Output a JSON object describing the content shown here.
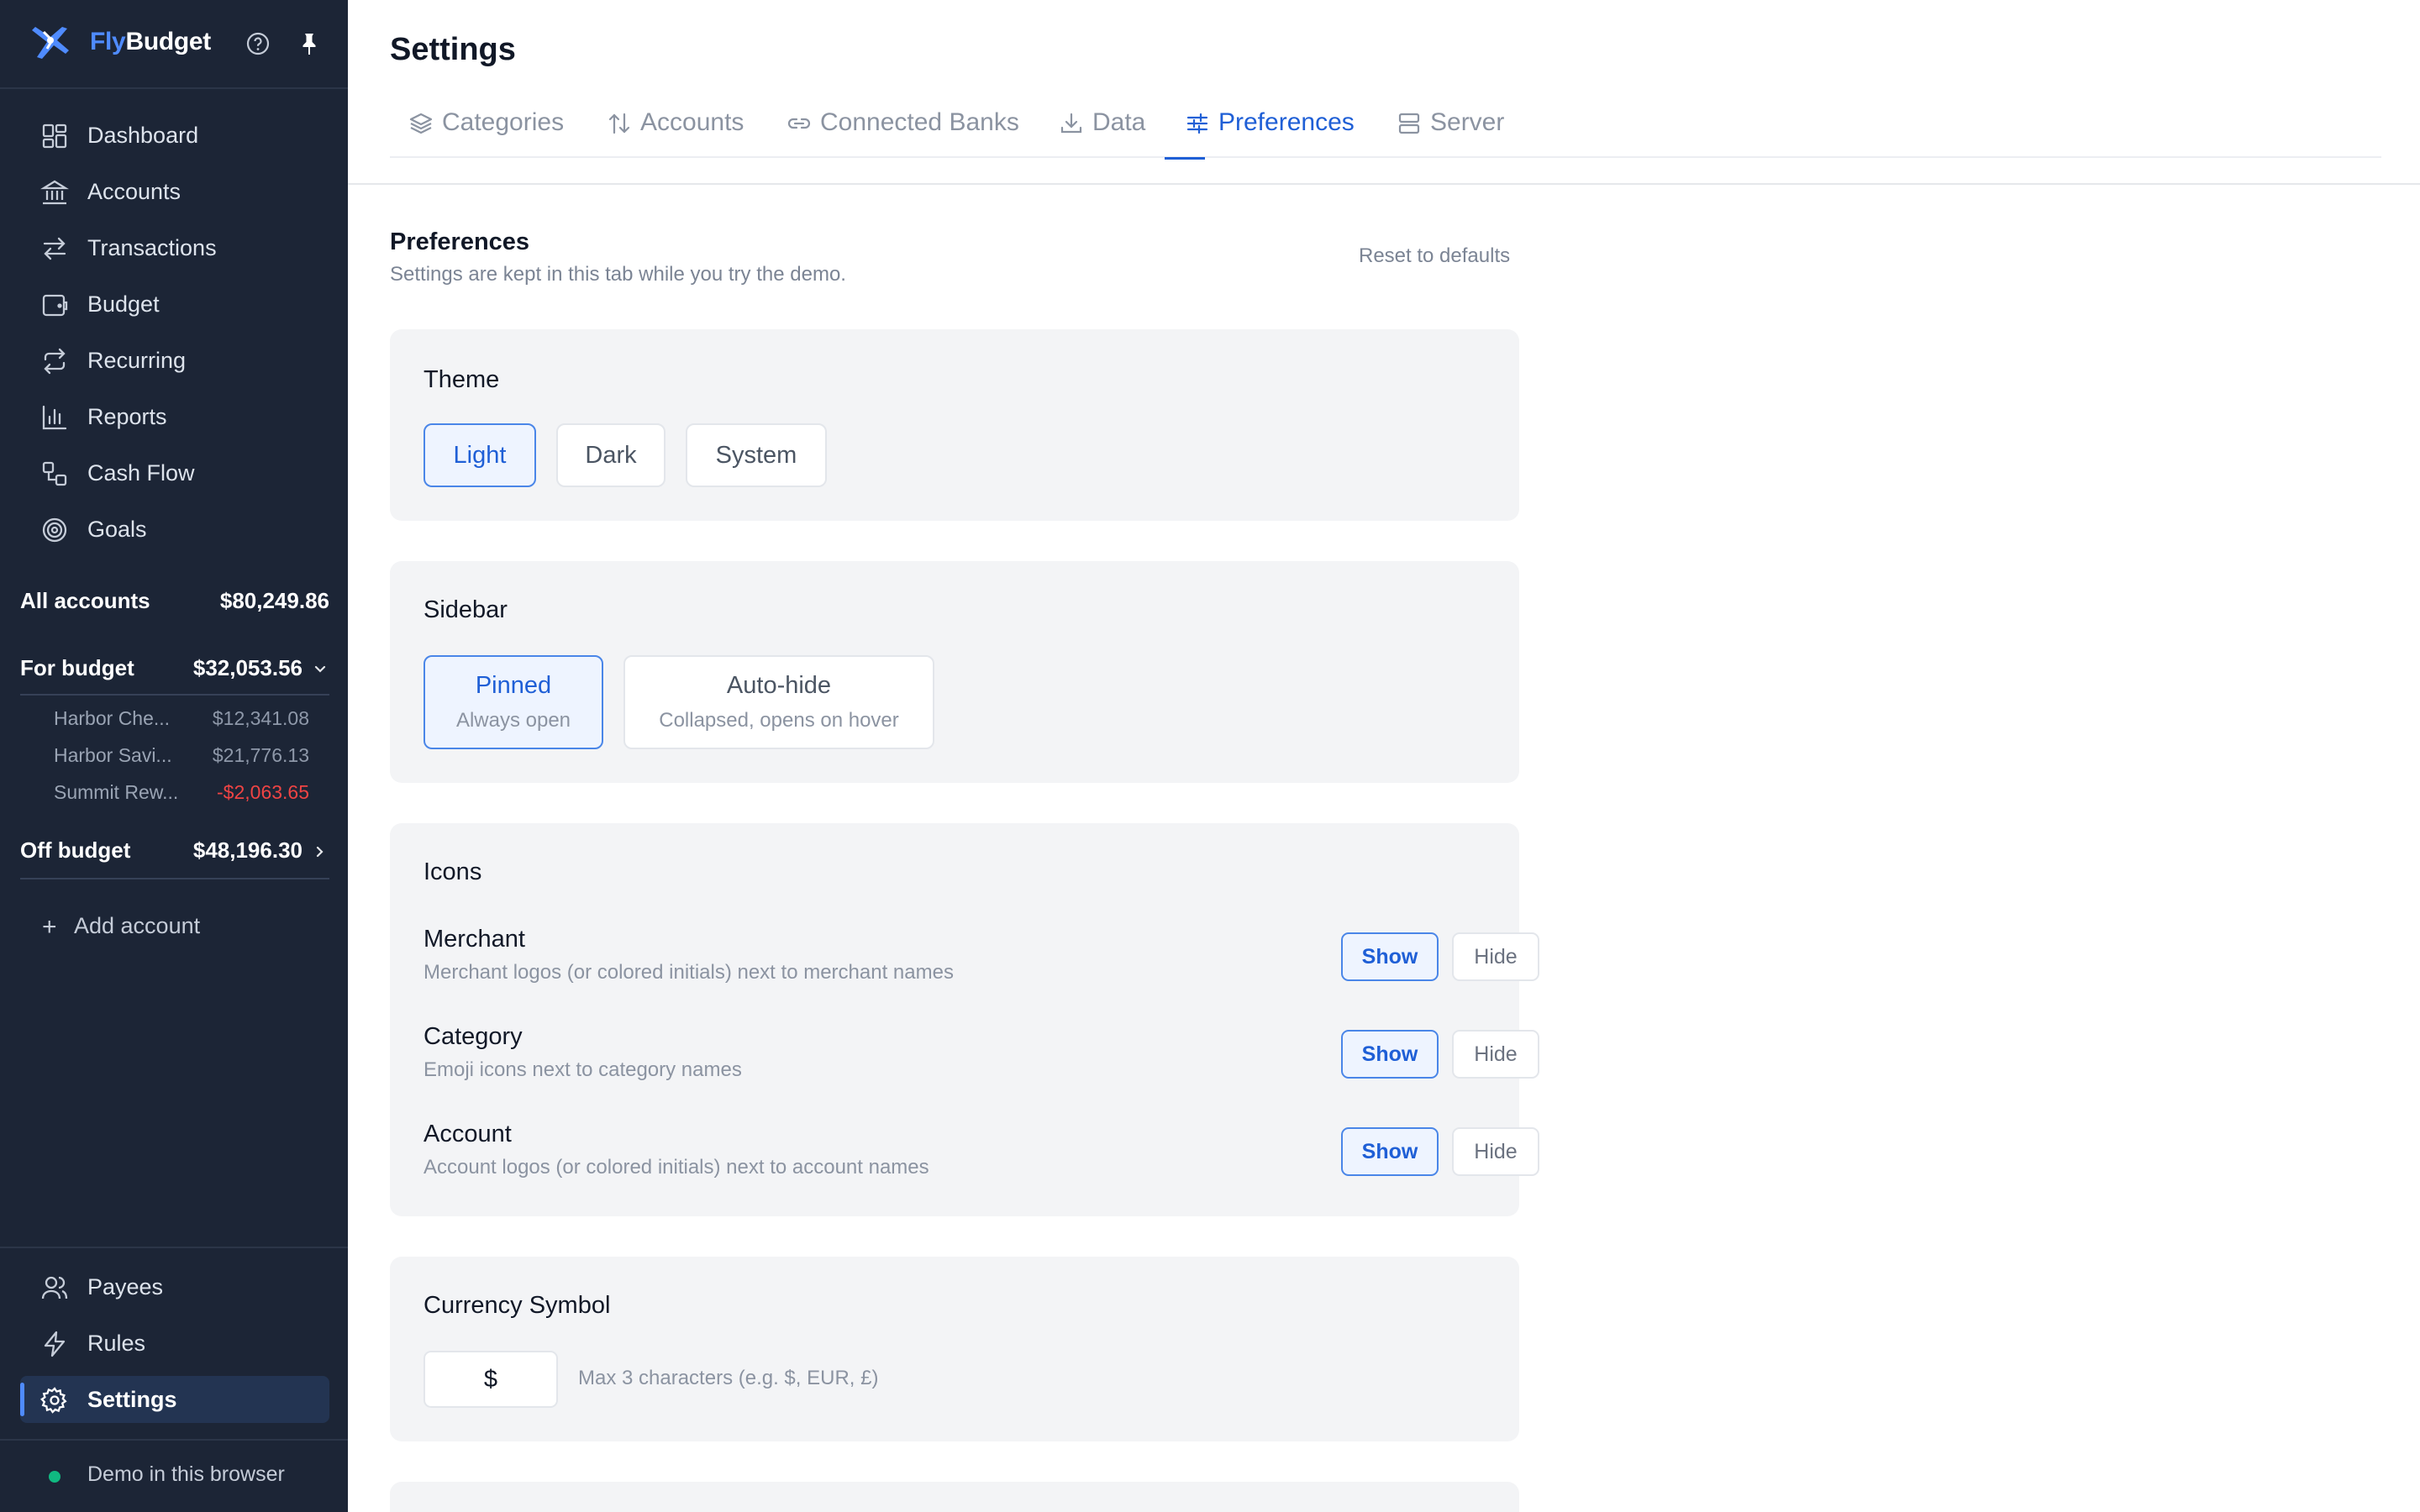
{
  "brand": {
    "name_part1": "Fly",
    "name_part2": "Budget"
  },
  "nav_top": [
    {
      "label": "Dashboard",
      "icon": "dashboard-icon"
    },
    {
      "label": "Accounts",
      "icon": "bank-icon"
    },
    {
      "label": "Transactions",
      "icon": "arrows-swap-icon"
    },
    {
      "label": "Budget",
      "icon": "wallet-icon"
    },
    {
      "label": "Recurring",
      "icon": "repeat-icon"
    },
    {
      "label": "Reports",
      "icon": "bar-chart-icon"
    },
    {
      "label": "Cash Flow",
      "icon": "flow-icon"
    },
    {
      "label": "Goals",
      "icon": "target-icon"
    }
  ],
  "accounts_summary": {
    "all_label": "All accounts",
    "all_value": "$80,249.86",
    "for_budget_label": "For budget",
    "for_budget_value": "$32,053.56",
    "sub_accounts": [
      {
        "name": "Harbor Che...",
        "amount": "$12,341.08"
      },
      {
        "name": "Harbor Savi...",
        "amount": "$21,776.13"
      },
      {
        "name": "Summit Rew...",
        "amount": "-$2,063.65"
      }
    ],
    "off_budget_label": "Off budget",
    "off_budget_value": "$48,196.30",
    "add_account": "Add account"
  },
  "nav_bottom": [
    {
      "label": "Payees",
      "icon": "users-icon"
    },
    {
      "label": "Rules",
      "icon": "bolt-icon"
    },
    {
      "label": "Settings",
      "icon": "gear-icon"
    }
  ],
  "footer_status": "Demo in this browser",
  "page_title": "Settings",
  "tabs": [
    {
      "label": "Categories",
      "icon": "layers-icon"
    },
    {
      "label": "Accounts",
      "icon": "sort-arrows-icon"
    },
    {
      "label": "Connected Banks",
      "icon": "link-icon"
    },
    {
      "label": "Data",
      "icon": "download-icon"
    },
    {
      "label": "Preferences",
      "icon": "sliders-icon"
    },
    {
      "label": "Server",
      "icon": "server-icon"
    }
  ],
  "active_tab": "Preferences",
  "section": {
    "title": "Preferences",
    "subtitle": "Settings are kept in this tab while you try the demo.",
    "reset": "Reset to defaults"
  },
  "theme": {
    "title": "Theme",
    "options": [
      "Light",
      "Dark",
      "System"
    ],
    "selected": "Light"
  },
  "sidebar_pref": {
    "title": "Sidebar",
    "options": [
      {
        "label": "Pinned",
        "desc": "Always open"
      },
      {
        "label": "Auto-hide",
        "desc": "Collapsed, opens on hover"
      }
    ],
    "selected": "Pinned"
  },
  "icons_pref": {
    "title": "Icons",
    "show_label": "Show",
    "hide_label": "Hide",
    "rows": [
      {
        "name": "Merchant",
        "desc": "Merchant logos (or colored initials) next to merchant names",
        "value": "Show"
      },
      {
        "name": "Category",
        "desc": "Emoji icons next to category names",
        "value": "Show"
      },
      {
        "name": "Account",
        "desc": "Account logos (or colored initials) next to account names",
        "value": "Show"
      }
    ]
  },
  "currency": {
    "title": "Currency Symbol",
    "value": "$",
    "hint": "Max 3 characters (e.g. $, EUR, £)"
  },
  "colors": {
    "accent": "#1f5fd6",
    "sidebar_bg": "#1c2536",
    "negative": "#ef4444",
    "status_ok": "#10b981"
  }
}
